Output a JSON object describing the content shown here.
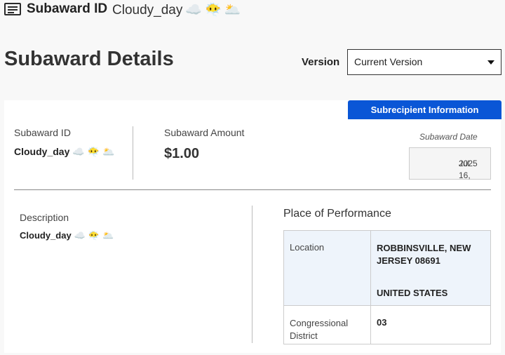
{
  "header": {
    "label": "Subaward ID",
    "value": "Cloudy_day",
    "emojis": [
      "☁️",
      "😶‍🌫️",
      "🌥️"
    ]
  },
  "page": {
    "title": "Subaward Details",
    "version_label": "Version",
    "version_selected": "Current Version"
  },
  "tab": {
    "label": "Subrecipient Information"
  },
  "summary": {
    "id_label": "Subaward ID",
    "id_value": "Cloudy_day",
    "amount_label": "Subaward Amount",
    "amount_value": "$1.00",
    "date_label": "Subaward Date",
    "date_line1": "Jul 16,",
    "date_line2": "2025"
  },
  "description": {
    "label": "Description",
    "value": "Cloudy_day"
  },
  "place_of_performance": {
    "title": "Place of Performance",
    "rows": [
      {
        "key": "Location",
        "line1": "ROBBINSVILLE, NEW",
        "line2": "JERSEY 08691",
        "line3": "UNITED STATES"
      },
      {
        "key_line1": "Congressional",
        "key_line2": "District",
        "value": "03"
      }
    ]
  },
  "colors": {
    "accent": "#0a56d6",
    "panel": "#eef4fb"
  }
}
